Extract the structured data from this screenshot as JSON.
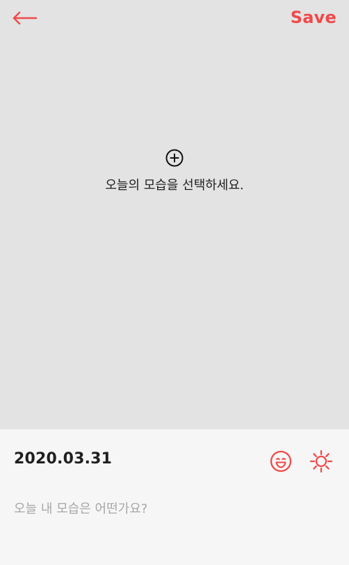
{
  "header": {
    "save_label": "Save",
    "accent_color": "#f04a4a",
    "back_icon": "arrow-left-icon"
  },
  "picker": {
    "icon": "plus-circle-icon",
    "label": "오늘의 모습을 선택하세요."
  },
  "entry": {
    "date": "2020.03.31",
    "memo_placeholder": "오늘 내 모습은 어떤가요?",
    "mood_icon": "smile-icon",
    "weather_icon": "sun-icon"
  }
}
